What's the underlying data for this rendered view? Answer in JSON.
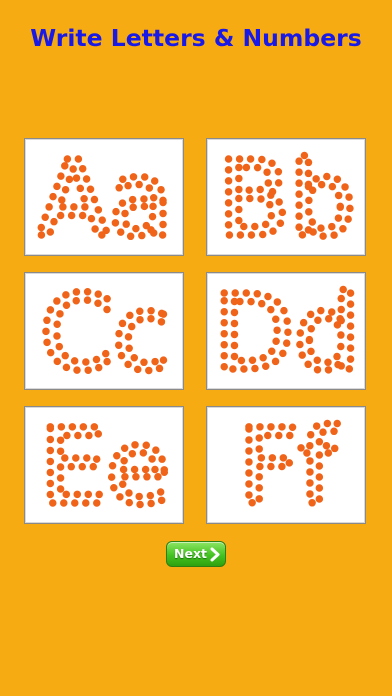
{
  "app": {
    "title": "Write Letters & Numbers"
  },
  "cards": [
    {
      "text": "Aa"
    },
    {
      "text": "Bb"
    },
    {
      "text": "Cc"
    },
    {
      "text": "Dd"
    },
    {
      "text": "Ee"
    },
    {
      "text": "Ff"
    }
  ],
  "next_button": {
    "label": "Next",
    "icon": "chevron-right-icon"
  },
  "colors": {
    "background": "#f7ab12",
    "title": "#1a1ae6",
    "dots": "#f0641a",
    "card": "#ffffff",
    "button": "#45c322"
  }
}
